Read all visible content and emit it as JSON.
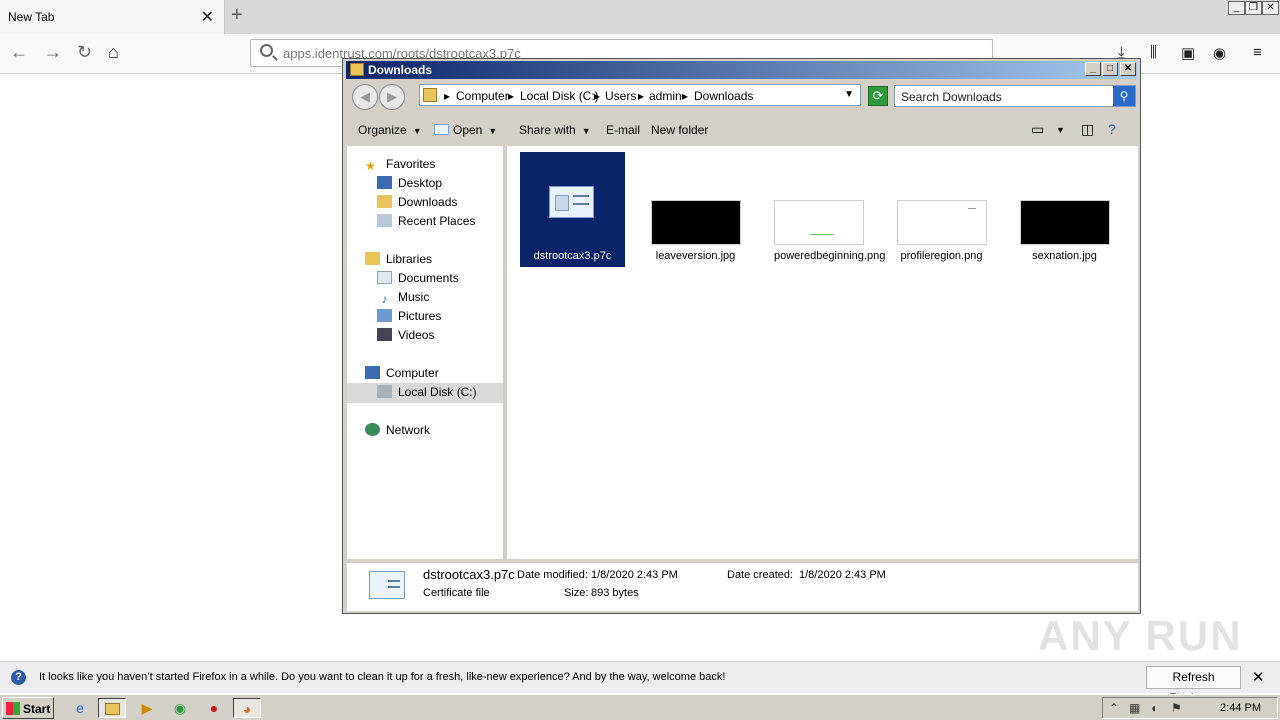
{
  "firefox": {
    "tab_title": "New Tab",
    "tab_close_icon": "✕",
    "new_tab_icon": "+",
    "url": "apps.identrust.com/roots/dstrootcax3.p7c"
  },
  "explorer": {
    "title": "Downloads",
    "breadcrumb": [
      "Computer",
      "Local Disk (C:)",
      "Users",
      "admin",
      "Downloads"
    ],
    "search_placeholder": "Search Downloads",
    "commands": {
      "organize": "Organize",
      "open": "Open",
      "share_with": "Share with",
      "email": "E-mail",
      "new_folder": "New folder"
    },
    "nav": {
      "favorites": "Favorites",
      "desktop": "Desktop",
      "downloads": "Downloads",
      "recent_places": "Recent Places",
      "libraries": "Libraries",
      "documents": "Documents",
      "music": "Music",
      "pictures": "Pictures",
      "videos": "Videos",
      "computer": "Computer",
      "local_disk": "Local Disk (C:)",
      "network": "Network"
    },
    "files": [
      {
        "name": "dstrootcax3.p7c",
        "type": "certificate",
        "selected": true
      },
      {
        "name": "leaveversion.jpg",
        "type": "image",
        "thumb_color": "#000000"
      },
      {
        "name": "poweredbeginning.png",
        "type": "image",
        "thumb_color": "#ffffff"
      },
      {
        "name": "profileregion.png",
        "type": "image",
        "thumb_color": "#ffffff"
      },
      {
        "name": "sexnation.jpg",
        "type": "image",
        "thumb_color": "#000000"
      }
    ],
    "details": {
      "filename": "dstrootcax3.p7c",
      "date_modified_label": "Date modified:",
      "date_modified": "1/8/2020 2:43 PM",
      "date_created_label": "Date created:",
      "date_created": "1/8/2020 2:43 PM",
      "file_type": "Certificate file",
      "size_label": "Size:",
      "size": "893 bytes"
    }
  },
  "notification": {
    "message": "It looks like you haven’t started Firefox in a while. Do you want to clean it up for a fresh, like-new experience? And by the way, welcome back!",
    "button": "Refresh Firefox…"
  },
  "watermark": "ANY RUN",
  "taskbar": {
    "start_label": "Start",
    "clock": "2:44 PM"
  },
  "colors": {
    "selection": "#0a246a",
    "titlebar_start": "#0a246a",
    "titlebar_end": "#a6caf0"
  }
}
